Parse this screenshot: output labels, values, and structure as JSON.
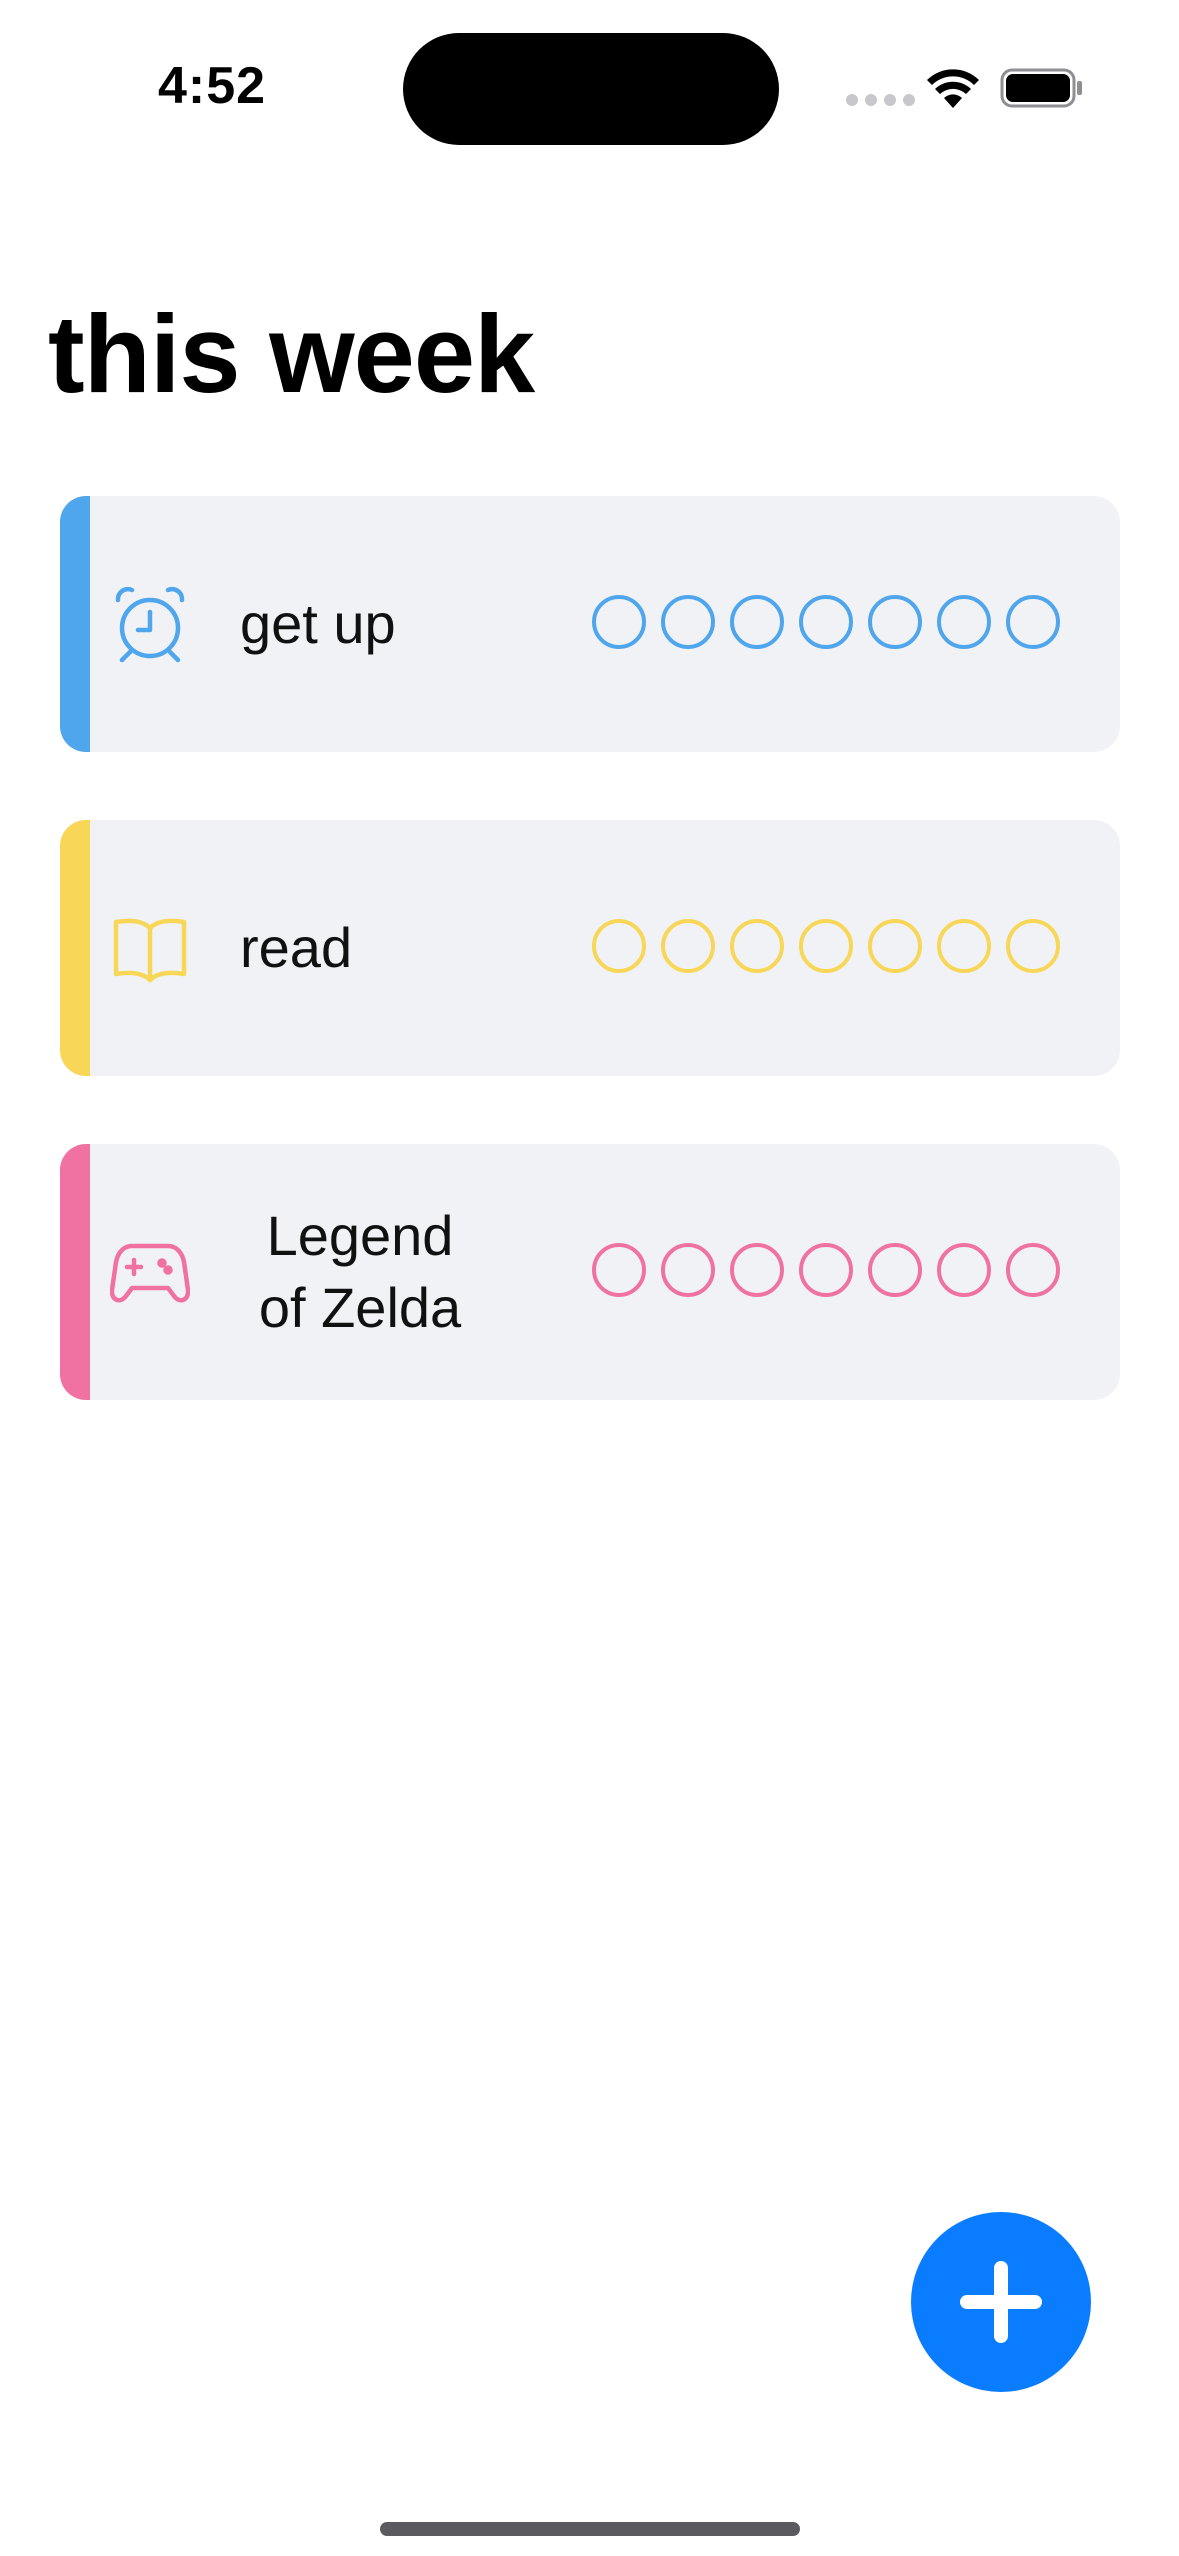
{
  "status_bar": {
    "time": "4:52"
  },
  "page": {
    "title": "this week"
  },
  "habits": [
    {
      "name": "get up",
      "icon": "alarm-clock-icon",
      "color": "#4fa6ec",
      "days": [
        false,
        false,
        false,
        false,
        false,
        false,
        false
      ]
    },
    {
      "name": "read",
      "icon": "book-icon",
      "color": "#f8d657",
      "days": [
        false,
        false,
        false,
        false,
        false,
        false,
        false
      ]
    },
    {
      "name": "Legend of Zelda",
      "icon": "game-controller-icon",
      "color": "#ef72a2",
      "days": [
        false,
        false,
        false,
        false,
        false,
        false,
        false
      ]
    }
  ],
  "add_button": {
    "icon": "plus-icon",
    "color": "#0a7cff"
  }
}
